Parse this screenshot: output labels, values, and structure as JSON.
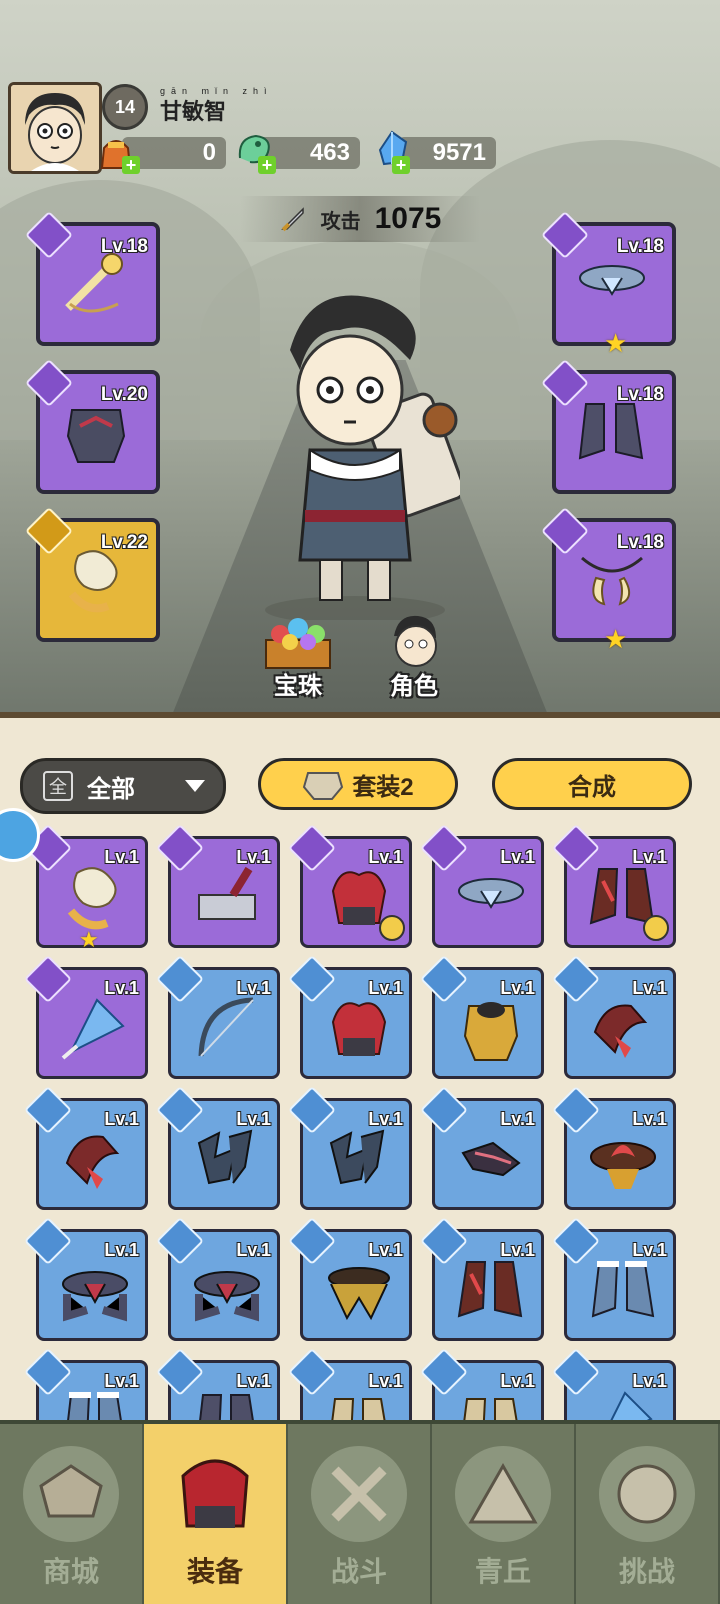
{
  "player": {
    "level": "14",
    "name": "甘敏智",
    "name_pinyin": "gān mǐn zhì"
  },
  "resources": [
    {
      "icon": "lucky-bag-icon",
      "value": "0"
    },
    {
      "icon": "jade-dragon-icon",
      "value": "463"
    },
    {
      "icon": "blue-crystal-icon",
      "value": "9571"
    }
  ],
  "attack": {
    "label": "攻击",
    "value": "1075"
  },
  "equipped": [
    {
      "slot": "weapon",
      "level": "Lv.18",
      "rarity": "purple",
      "icon": "whip-weapon-icon",
      "star": false
    },
    {
      "slot": "armor",
      "level": "Lv.20",
      "rarity": "purple",
      "icon": "chest-armor-icon",
      "star": false
    },
    {
      "slot": "accessory",
      "level": "Lv.22",
      "rarity": "gold",
      "icon": "fur-bracer-icon",
      "star": false
    },
    {
      "slot": "belt",
      "level": "Lv.18",
      "rarity": "purple",
      "icon": "belt-icon",
      "star": true
    },
    {
      "slot": "boots",
      "level": "Lv.18",
      "rarity": "purple",
      "icon": "boots-icon",
      "star": false
    },
    {
      "slot": "amulet",
      "level": "Lv.18",
      "rarity": "purple",
      "icon": "tooth-necklace-icon",
      "star": true
    }
  ],
  "scene_buttons": {
    "orb": "宝珠",
    "character": "角色"
  },
  "filter": {
    "box": "全",
    "label": "全部"
  },
  "set_button": "套装2",
  "craft_button": "合成",
  "inventory": [
    {
      "level": "Lv.1",
      "rarity": "purple",
      "icon": "fur-bracer-icon",
      "star": true,
      "badge": false
    },
    {
      "level": "Lv.1",
      "rarity": "purple",
      "icon": "hammer-icon",
      "star": false,
      "badge": false
    },
    {
      "level": "Lv.1",
      "rarity": "purple",
      "icon": "flame-helmet-icon",
      "star": false,
      "badge": true
    },
    {
      "level": "Lv.1",
      "rarity": "purple",
      "icon": "belt-icon",
      "star": false,
      "badge": false
    },
    {
      "level": "Lv.1",
      "rarity": "purple",
      "icon": "flame-boots-icon",
      "star": false,
      "badge": true
    },
    {
      "level": "Lv.1",
      "rarity": "purple",
      "icon": "crystal-pendant-icon",
      "star": false,
      "badge": false
    },
    {
      "level": "Lv.1",
      "rarity": "blue",
      "icon": "bow-icon",
      "star": false,
      "badge": false
    },
    {
      "level": "Lv.1",
      "rarity": "blue",
      "icon": "flame-helmet-icon",
      "star": false,
      "badge": false
    },
    {
      "level": "Lv.1",
      "rarity": "blue",
      "icon": "gold-armor-icon",
      "star": false,
      "badge": false
    },
    {
      "level": "Lv.1",
      "rarity": "blue",
      "icon": "red-bracer-icon",
      "star": false,
      "badge": false
    },
    {
      "level": "Lv.1",
      "rarity": "blue",
      "icon": "red-bracer-icon",
      "star": false,
      "badge": false
    },
    {
      "level": "Lv.1",
      "rarity": "blue",
      "icon": "spiked-bracer-icon",
      "star": false,
      "badge": false
    },
    {
      "level": "Lv.1",
      "rarity": "blue",
      "icon": "spiked-bracer-icon",
      "star": false,
      "badge": false
    },
    {
      "level": "Lv.1",
      "rarity": "blue",
      "icon": "thorn-bracer-icon",
      "star": false,
      "badge": false
    },
    {
      "level": "Lv.1",
      "rarity": "blue",
      "icon": "lotus-belt-icon",
      "star": false,
      "badge": false
    },
    {
      "level": "Lv.1",
      "rarity": "blue",
      "icon": "dark-belt-icon",
      "star": false,
      "badge": false
    },
    {
      "level": "Lv.1",
      "rarity": "blue",
      "icon": "dark-belt-icon",
      "star": false,
      "badge": false
    },
    {
      "level": "Lv.1",
      "rarity": "blue",
      "icon": "gold-belt-icon",
      "star": false,
      "badge": false
    },
    {
      "level": "Lv.1",
      "rarity": "blue",
      "icon": "flame-boots-icon",
      "star": false,
      "badge": false
    },
    {
      "level": "Lv.1",
      "rarity": "blue",
      "icon": "frost-boots-icon",
      "star": false,
      "badge": false
    },
    {
      "level": "Lv.1",
      "rarity": "blue",
      "icon": "frost-boots-icon",
      "star": false,
      "badge": false
    },
    {
      "level": "Lv.1",
      "rarity": "blue",
      "icon": "dark-boots-icon",
      "star": false,
      "badge": false
    },
    {
      "level": "Lv.1",
      "rarity": "blue",
      "icon": "bone-boots-icon",
      "star": false,
      "badge": false
    },
    {
      "level": "Lv.1",
      "rarity": "blue",
      "icon": "bone-boots-icon",
      "star": false,
      "badge": false
    },
    {
      "level": "Lv.1",
      "rarity": "blue",
      "icon": "crystal-pendant-icon",
      "star": false,
      "badge": false
    }
  ],
  "nav": [
    {
      "label": "商城",
      "icon": "shop-icon",
      "active": false
    },
    {
      "label": "装备",
      "icon": "equipment-icon",
      "active": true
    },
    {
      "label": "战斗",
      "icon": "battle-icon",
      "active": false
    },
    {
      "label": "青丘",
      "icon": "mountain-icon",
      "active": false
    },
    {
      "label": "挑战",
      "icon": "challenge-icon",
      "active": false
    }
  ]
}
